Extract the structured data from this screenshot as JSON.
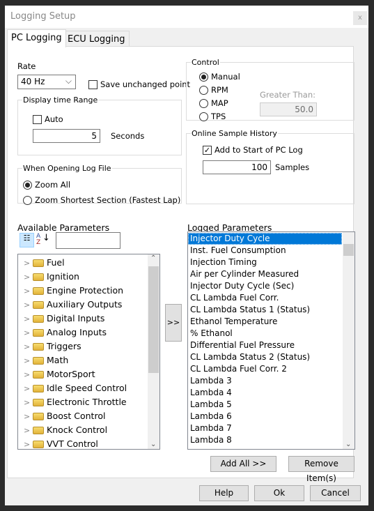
{
  "window": {
    "title": "Logging Setup",
    "close": "x"
  },
  "tabs": [
    {
      "label": "PC Logging",
      "active": true
    },
    {
      "label": "ECU Logging",
      "active": false
    }
  ],
  "rate": {
    "label": "Rate",
    "value": "40 Hz",
    "save_unchanged": "Save unchanged point",
    "save_unchanged_checked": false
  },
  "display_time": {
    "legend": "Display time Range",
    "auto_label": "Auto",
    "auto_checked": false,
    "value": "5",
    "unit": "Seconds"
  },
  "open_log": {
    "legend": "When Opening Log File",
    "options": [
      "Zoom All",
      "Zoom Shortest Section (Fastest Lap)"
    ],
    "selected": 0
  },
  "control": {
    "legend": "Control",
    "options": [
      "Manual",
      "RPM",
      "MAP",
      "TPS"
    ],
    "selected": 0,
    "greater_than_label": "Greater Than:",
    "greater_than_value": "50.0"
  },
  "history": {
    "legend": "Online Sample History",
    "add_label": "Add to Start of PC Log",
    "add_checked": true,
    "value": "100",
    "unit": "Samples"
  },
  "available": {
    "label": "Available Parameters",
    "search": "",
    "items": [
      "Fuel",
      "Ignition",
      "Engine Protection",
      "Auxiliary Outputs",
      "Digital Inputs",
      "Analog Inputs",
      "Triggers",
      "Math",
      "MotorSport",
      "Idle Speed Control",
      "Electronic Throttle",
      "Boost Control",
      "Knock Control",
      "VVT Control"
    ]
  },
  "move_button": ">>",
  "logged": {
    "label": "Logged Parameters",
    "selected": 0,
    "items": [
      "Injector Duty Cycle",
      "Inst. Fuel Consumption",
      "Injection Timing",
      "Air per Cylinder Measured",
      "Injector Duty Cycle (Sec)",
      "CL Lambda  Fuel  Corr.",
      "CL Lambda Status 1 (Status)",
      "Ethanol Temperature",
      "% Ethanol",
      "Differential Fuel Pressure",
      "CL Lambda Status 2 (Status)",
      "CL Lambda  Fuel  Corr. 2",
      "Lambda 3",
      "Lambda 4",
      "Lambda 5",
      "Lambda 6",
      "Lambda 7",
      "Lambda 8"
    ]
  },
  "buttons": {
    "add_all": "Add All >>",
    "remove": "Remove Item(s)",
    "help": "Help",
    "ok": "Ok",
    "cancel": "Cancel"
  }
}
